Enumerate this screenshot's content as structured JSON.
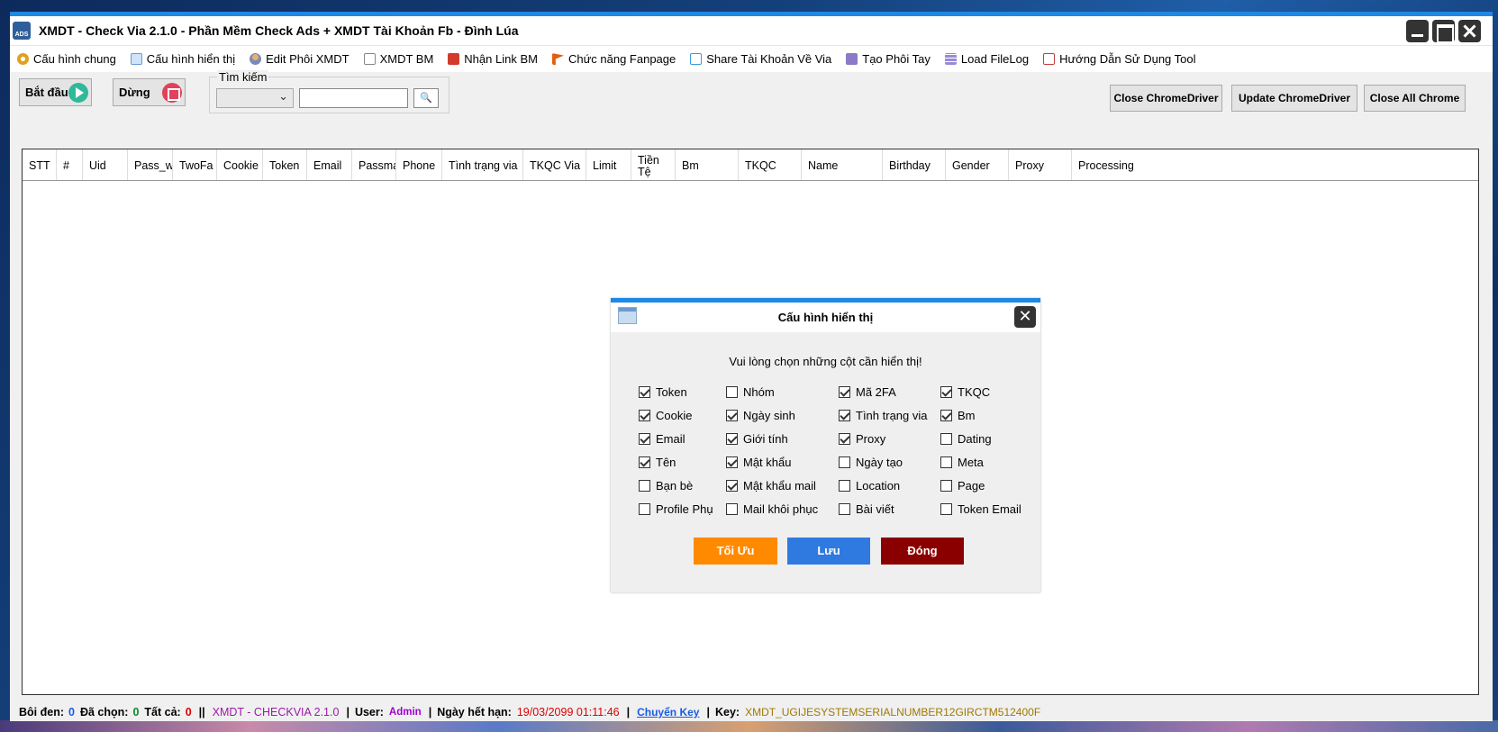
{
  "window": {
    "title": "XMDT - Check Via 2.1.0 - Phần Mềm Check Ads + XMDT Tài Khoản Fb - Đình Lúa",
    "icon_label": "ADS"
  },
  "menu": [
    {
      "label": "Cấu hình chung",
      "icon": "gear-icon"
    },
    {
      "label": "Cấu hình hiển thị",
      "icon": "window-icon"
    },
    {
      "label": "Edit Phôi XMDT",
      "icon": "user-icon"
    },
    {
      "label": "XMDT BM",
      "icon": "document-icon"
    },
    {
      "label": "Nhận Link BM",
      "icon": "briefcase-icon"
    },
    {
      "label": "Chức năng Fanpage",
      "icon": "flag-icon"
    },
    {
      "label": "Share Tài Khoản Về Via",
      "icon": "share-icon"
    },
    {
      "label": "Tạo Phôi Tay",
      "icon": "id-card-icon"
    },
    {
      "label": "Load FileLog",
      "icon": "stack-icon"
    },
    {
      "label": "Hướng Dẫn Sử Dụng Tool",
      "icon": "help-icon"
    }
  ],
  "toolbar": {
    "start_label": "Bắt đầu",
    "stop_label": "Dừng",
    "search_group_label": "Tìm kiếm",
    "search_select_value": "",
    "search_input_value": "",
    "close_chromedriver": "Close ChromeDriver",
    "update_chromedriver": "Update ChromeDriver",
    "close_all_chrome": "Close All Chrome"
  },
  "grid": {
    "columns": [
      "STT",
      "#",
      "Uid",
      "Pass_w",
      "TwoFa",
      "Cookie",
      "Token",
      "Email",
      "Passmai",
      "Phone",
      "Tình trạng via",
      "TKQC Via",
      "Limit",
      "Tiền Tệ",
      "Bm",
      "TKQC",
      "Name",
      "Birthday",
      "Gender",
      "Proxy",
      "Processing"
    ],
    "rows": []
  },
  "status": {
    "boi_den_label": "Bôi đen:",
    "boi_den_value": "0",
    "da_chon_label": "Đã chọn:",
    "da_chon_value": "0",
    "tat_ca_label": "Tất cả:",
    "tat_ca_value": "0",
    "app_name": "XMDT - CHECKVIA  2.1.0",
    "user_label": "User:",
    "user_value": "Admin",
    "expiry_label": "Ngày hết hạn:",
    "expiry_value": "19/03/2099 01:11:46",
    "change_key": "Chuyển Key",
    "key_label": "Key:",
    "key_value": "XMDT_UGIJESYSTEMSERIALNUMBER12GIRCTM512400F"
  },
  "dialog": {
    "title": "Cấu hình hiển thị",
    "prompt": "Vui lòng chọn những cột cần hiển thị!",
    "options": [
      {
        "label": "Token",
        "checked": true
      },
      {
        "label": "Nhóm",
        "checked": false
      },
      {
        "label": "Mã 2FA",
        "checked": true
      },
      {
        "label": "TKQC",
        "checked": true
      },
      {
        "label": "Cookie",
        "checked": true
      },
      {
        "label": "Ngày sinh",
        "checked": true
      },
      {
        "label": "Tình trạng via",
        "checked": true
      },
      {
        "label": "Bm",
        "checked": true
      },
      {
        "label": "Email",
        "checked": true
      },
      {
        "label": "Giới tính",
        "checked": true
      },
      {
        "label": "Proxy",
        "checked": true
      },
      {
        "label": "Dating",
        "checked": false
      },
      {
        "label": "Tên",
        "checked": true
      },
      {
        "label": "Mật khẩu",
        "checked": true
      },
      {
        "label": "Ngày tạo",
        "checked": false
      },
      {
        "label": "Meta",
        "checked": false
      },
      {
        "label": "Bạn bè",
        "checked": false
      },
      {
        "label": "Mật khẩu mail",
        "checked": true
      },
      {
        "label": "Location",
        "checked": false
      },
      {
        "label": "Page",
        "checked": false
      },
      {
        "label": "Profile Phụ",
        "checked": false
      },
      {
        "label": "Mail khôi phục",
        "checked": false
      },
      {
        "label": "Bài viết",
        "checked": false
      },
      {
        "label": "Token Email",
        "checked": false
      }
    ],
    "btn_optimize": "Tối Ưu",
    "btn_save": "Lưu",
    "btn_close": "Đóng"
  }
}
